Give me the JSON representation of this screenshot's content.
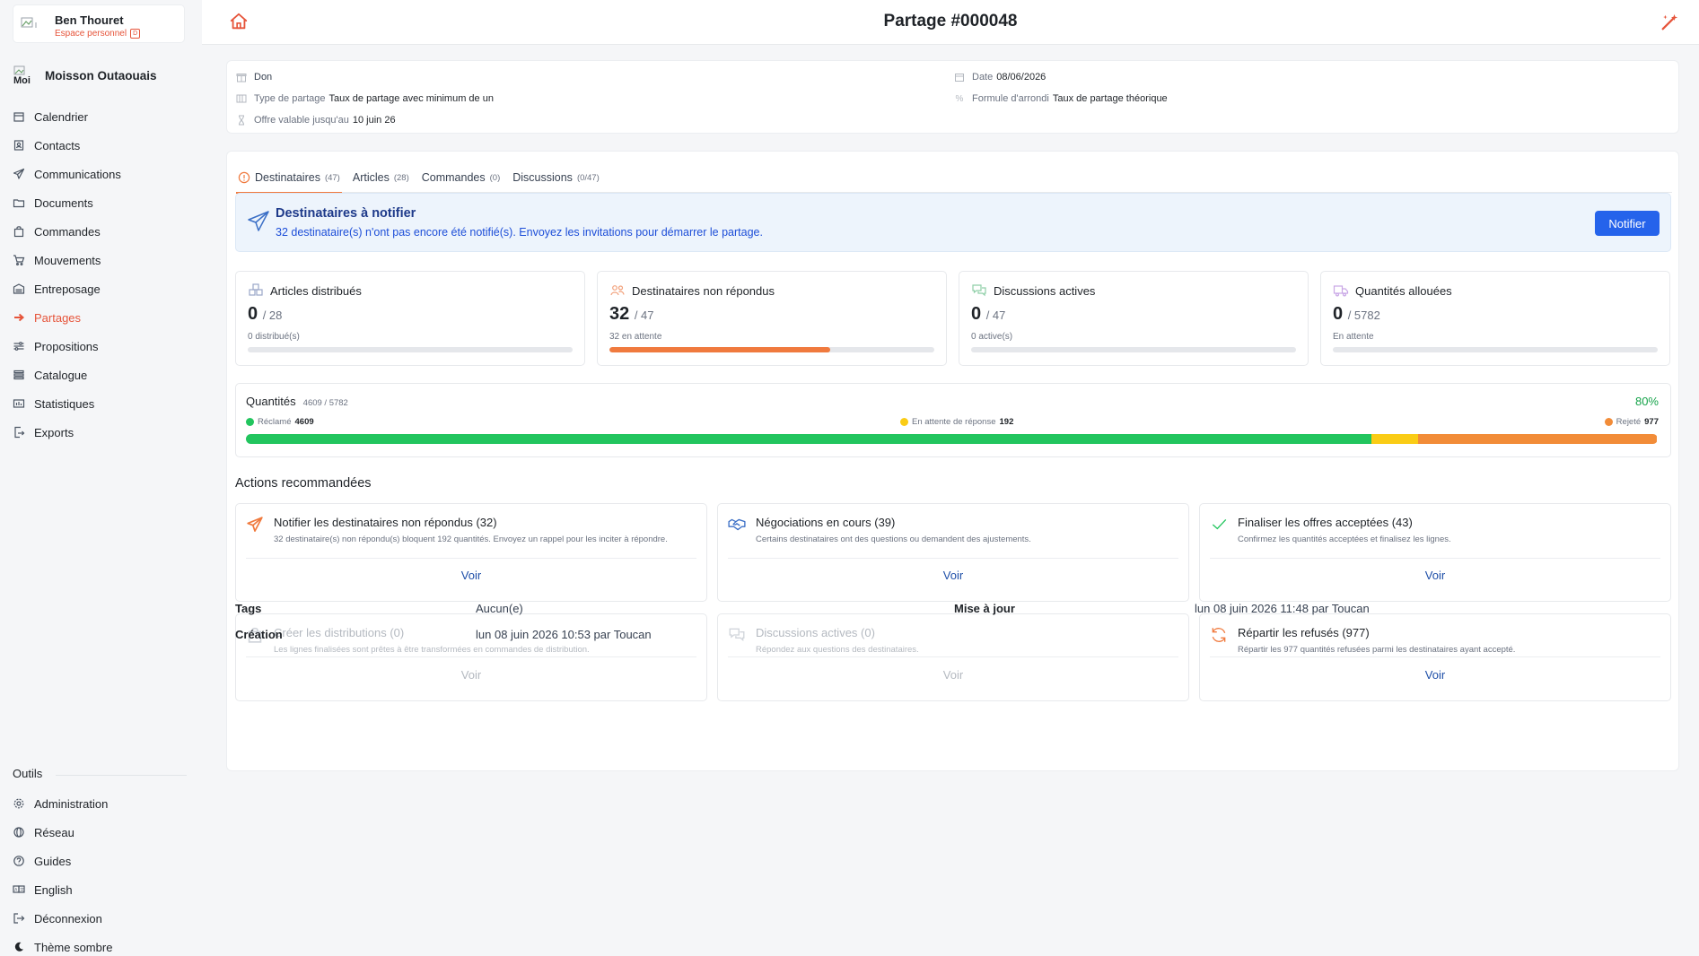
{
  "user": {
    "name": "Ben Thouret",
    "space": "Espace personnel",
    "badge": "D"
  },
  "org": {
    "name": "Moisson Outaouais",
    "logo_alt": "Moi"
  },
  "nav": [
    {
      "label": "Calendrier",
      "icon": "calendar-icon"
    },
    {
      "label": "Contacts",
      "icon": "contacts-icon"
    },
    {
      "label": "Communications",
      "icon": "send-icon"
    },
    {
      "label": "Documents",
      "icon": "folder-icon"
    },
    {
      "label": "Commandes",
      "icon": "bag-icon"
    },
    {
      "label": "Mouvements",
      "icon": "cart-icon"
    },
    {
      "label": "Entreposage",
      "icon": "warehouse-icon"
    },
    {
      "label": "Partages",
      "icon": "arrow-right-icon",
      "active": true
    },
    {
      "label": "Propositions",
      "icon": "sliders-icon"
    },
    {
      "label": "Catalogue",
      "icon": "list-icon"
    },
    {
      "label": "Statistiques",
      "icon": "chart-icon"
    },
    {
      "label": "Exports",
      "icon": "export-icon"
    }
  ],
  "tools": {
    "title": "Outils",
    "items": [
      {
        "label": "Administration",
        "icon": "gear-icon"
      },
      {
        "label": "Réseau",
        "icon": "network-icon"
      },
      {
        "label": "Guides",
        "icon": "help-icon"
      },
      {
        "label": "English",
        "icon": "language-icon"
      },
      {
        "label": "Déconnexion",
        "icon": "logout-icon"
      },
      {
        "label": "Thème sombre",
        "icon": "moon-icon"
      }
    ]
  },
  "header": {
    "title": "Partage #000048"
  },
  "info": {
    "type": "Don",
    "share_type_label": "Type de partage",
    "share_type_value": "Taux de partage avec minimum de un",
    "valid_label": "Offre valable jusqu'au",
    "valid_value": "10 juin 26",
    "date_label": "Date",
    "date_value": "08/06/2026",
    "round_label": "Formule d'arrondi",
    "round_value": "Taux de partage théorique"
  },
  "tabs": [
    {
      "label": "Destinataires",
      "count": "(47)",
      "active": true
    },
    {
      "label": "Articles",
      "count": "(28)"
    },
    {
      "label": "Commandes",
      "count": "(0)"
    },
    {
      "label": "Discussions",
      "count": "(0/47)"
    }
  ],
  "banner": {
    "title": "Destinataires à notifier",
    "text": "32 destinataire(s) n'ont pas encore été notifié(s). Envoyez les invitations pour démarrer le partage.",
    "button": "Notifier"
  },
  "stats": [
    {
      "title": "Articles distribués",
      "value": "0",
      "total": "/ 28",
      "sub": "0 distribué(s)",
      "progress": 0,
      "icon": "boxes-icon"
    },
    {
      "title": "Destinataires non répondus",
      "value": "32",
      "total": "/ 47",
      "sub": "32 en attente",
      "progress": 0.68,
      "icon": "users-icon"
    },
    {
      "title": "Discussions actives",
      "value": "0",
      "total": "/ 47",
      "sub": "0 active(s)",
      "progress": 0,
      "icon": "chat-icon"
    },
    {
      "title": "Quantités allouées",
      "value": "0",
      "total": "/ 5782",
      "sub": "En attente",
      "progress": 0,
      "icon": "truck-icon"
    }
  ],
  "quantities": {
    "title": "Quantités",
    "sub": "4609 / 5782",
    "pct": "80%",
    "claimed_label": "Réclamé",
    "claimed": 4609,
    "waiting_label": "En attente de réponse",
    "waiting": 192,
    "rejected_label": "Rejeté",
    "rejected": 977,
    "total": 5782,
    "colors": {
      "claimed": "#22c55e",
      "waiting": "#facc15",
      "rejected": "#f28c38"
    }
  },
  "actions_title": "Actions recommandées",
  "actions": [
    {
      "title": "Notifier les destinataires non répondus (32)",
      "desc": "32 destinataire(s) non répondu(s) bloquent 192 quantités. Envoyez un rappel pour les inciter à répondre.",
      "button": "Voir",
      "icon": "send-icon",
      "disabled": false
    },
    {
      "title": "Négociations en cours (39)",
      "desc": "Certains destinataires ont des questions ou demandent des ajustements.",
      "button": "Voir",
      "icon": "handshake-icon",
      "disabled": false
    },
    {
      "title": "Finaliser les offres acceptées (43)",
      "desc": "Confirmez les quantités acceptées et finalisez les lignes.",
      "button": "Voir",
      "icon": "check-icon",
      "disabled": false
    },
    {
      "title": "Créer les distributions (0)",
      "desc": "Les lignes finalisées sont prêtes à être transformées en commandes de distribution.",
      "button": "Voir",
      "icon": "bag-icon",
      "disabled": true
    },
    {
      "title": "Discussions actives (0)",
      "desc": "Répondez aux questions des destinataires.",
      "button": "Voir",
      "icon": "chat-icon",
      "disabled": true
    },
    {
      "title": "Répartir les refusés (977)",
      "desc": "Répartir les 977 quantités refusées parmi les destinataires ayant accepté.",
      "button": "Voir",
      "icon": "refresh-icon",
      "disabled": false
    }
  ],
  "meta": {
    "tags_label": "Tags",
    "tags_value": "Aucun(e)",
    "created_label": "Création",
    "created_value": "lun 08 juin 2026 10:53 par Toucan",
    "updated_label": "Mise à jour",
    "updated_value": "lun 08 juin 2026 11:48 par Toucan"
  }
}
